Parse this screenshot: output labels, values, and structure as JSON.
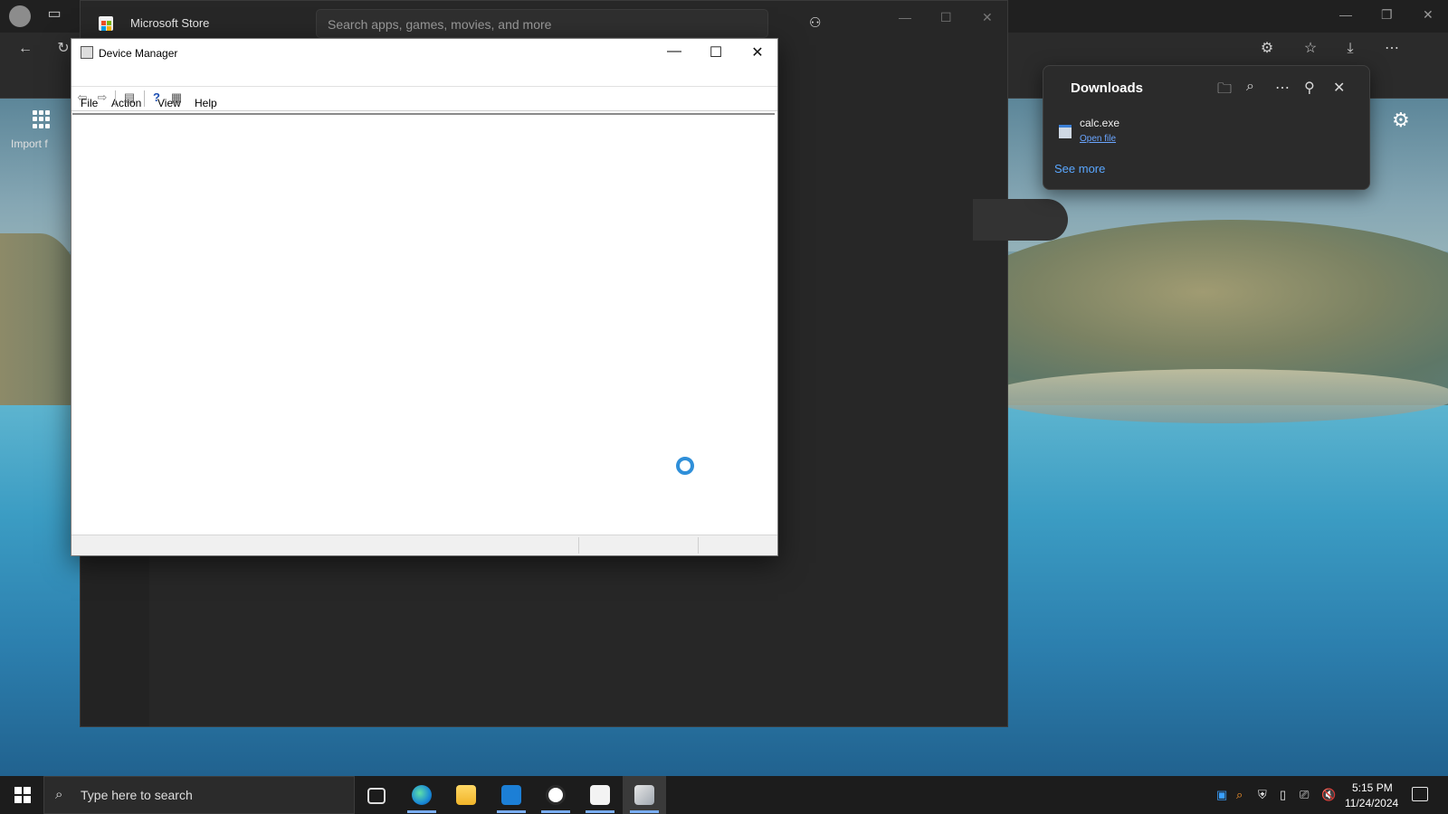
{
  "store": {
    "title": "Microsoft Store",
    "search_placeholder": "Search apps, games, movies, and more"
  },
  "edge": {
    "favorites_import": "Import f"
  },
  "downloads": {
    "title": "Downloads",
    "file_name": "calc.exe",
    "open_file": "Open file",
    "see_more": "See more"
  },
  "device_manager": {
    "title": "Device Manager",
    "menu": [
      "File",
      "Action",
      "View",
      "Help"
    ]
  },
  "taskbar": {
    "search_placeholder": "Type here to search",
    "time": "5:15 PM",
    "date": "11/24/2024"
  },
  "icons": {
    "start": "windows-logo-icon",
    "search": "magnifier-icon",
    "task_view": "task-view-icon",
    "edge": "edge-icon",
    "explorer": "folder-icon",
    "clock_app": "clock-icon",
    "store": "store-icon",
    "device_manager": "device-manager-icon"
  },
  "colors": {
    "accent": "#2f8fd9",
    "link": "#6aa5ff",
    "taskbar": "#1c1c1c",
    "window": "#ffffff"
  }
}
